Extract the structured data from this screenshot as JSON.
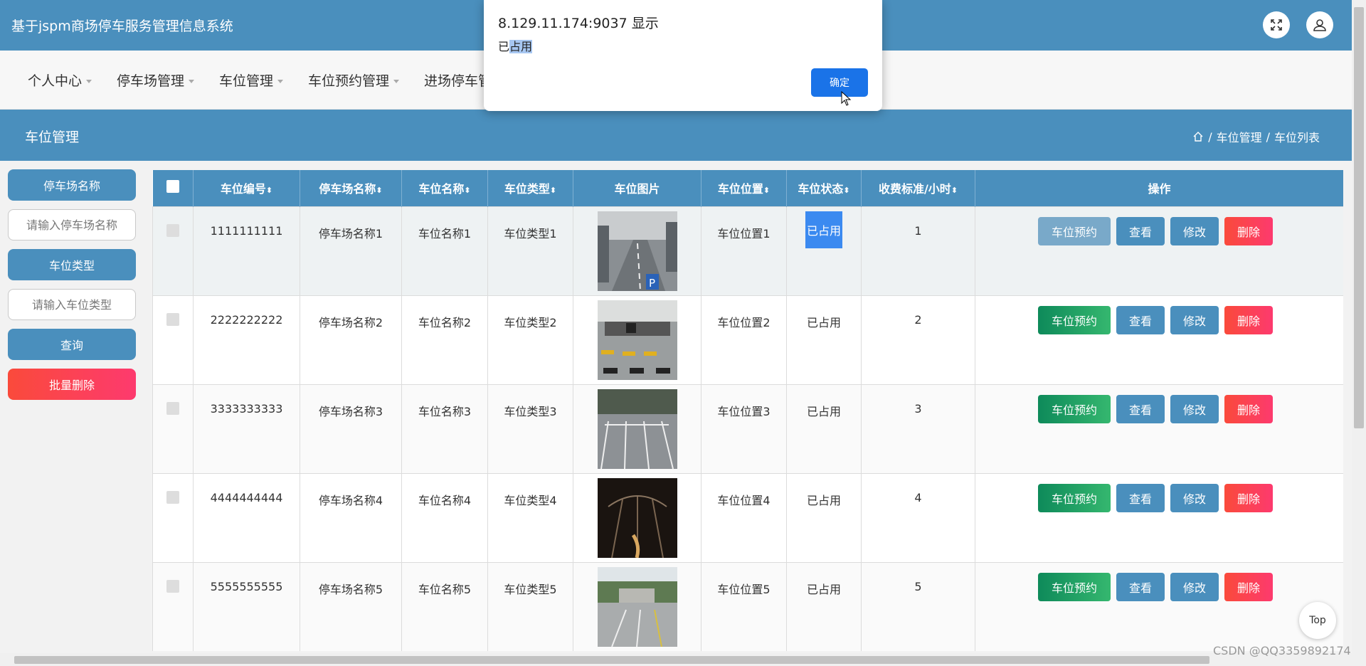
{
  "app": {
    "title": "基于jspm商场停车服务管理信息系统"
  },
  "nav": {
    "items": [
      {
        "label": "个人中心"
      },
      {
        "label": "停车场管理"
      },
      {
        "label": "车位管理"
      },
      {
        "label": "车位预约管理"
      },
      {
        "label": "进场停车管"
      }
    ]
  },
  "section": {
    "title": "车位管理",
    "breadcrumb": [
      "车位管理",
      "车位列表"
    ],
    "separator": "/"
  },
  "search": {
    "lot_label": "停车场名称",
    "lot_placeholder": "请输入停车场名称",
    "type_label": "车位类型",
    "type_placeholder": "请输入车位类型",
    "query_button": "查询",
    "batch_delete_button": "批量删除"
  },
  "table": {
    "headers": [
      "车位编号",
      "停车场名称",
      "车位名称",
      "车位类型",
      "车位图片",
      "车位位置",
      "车位状态",
      "收费标准/小时",
      "操作"
    ],
    "sort_glyph": "⬍",
    "rows": [
      {
        "code": "1111111111",
        "lot": "停车场名称1",
        "name": "车位名称1",
        "type": "车位类型1",
        "location": "车位位置1",
        "status": "已占用",
        "fee": "1"
      },
      {
        "code": "2222222222",
        "lot": "停车场名称2",
        "name": "车位名称2",
        "type": "车位类型2",
        "location": "车位位置2",
        "status": "已占用",
        "fee": "2"
      },
      {
        "code": "3333333333",
        "lot": "停车场名称3",
        "name": "车位名称3",
        "type": "车位类型3",
        "location": "车位位置3",
        "status": "已占用",
        "fee": "3"
      },
      {
        "code": "4444444444",
        "lot": "停车场名称4",
        "name": "车位名称4",
        "type": "车位类型4",
        "location": "车位位置4",
        "status": "已占用",
        "fee": "4"
      },
      {
        "code": "5555555555",
        "lot": "停车场名称5",
        "name": "车位名称5",
        "type": "车位类型5",
        "location": "车位位置5",
        "status": "已占用",
        "fee": "5"
      }
    ],
    "actions": {
      "reserve": "车位预约",
      "view": "查看",
      "edit": "修改",
      "delete": "删除"
    }
  },
  "dialog": {
    "title": "8.129.11.174:9037 显示",
    "msg_prefix": "已",
    "msg_highlight": "占用",
    "ok": "确定"
  },
  "top_button": "Top",
  "watermark": "CSDN @QQ3359892174",
  "colors": {
    "primary": "#4a8fbd",
    "success": "#1a9a62",
    "danger": "#fb4450",
    "dialog_ok": "#1a73e8"
  }
}
